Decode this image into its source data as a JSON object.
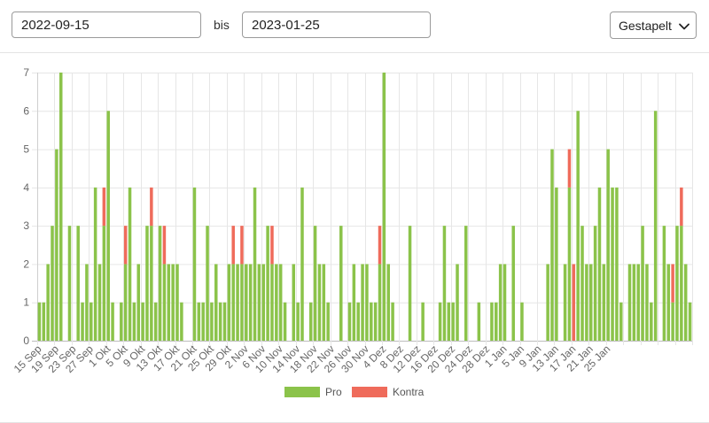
{
  "filter": {
    "from_value": "2022-09-15",
    "separator": "bis",
    "to_value": "2023-01-25",
    "mode_label": "Gestapelt"
  },
  "colors": {
    "pro": "#8bc34a",
    "kontra": "#ef6b5b"
  },
  "chart_data": {
    "type": "bar",
    "stacked": true,
    "title": "",
    "xlabel": "",
    "ylabel": "",
    "ylim": [
      0,
      7
    ],
    "yticks": [
      0,
      1,
      2,
      3,
      4,
      5,
      6,
      7
    ],
    "grid": true,
    "legend_position": "bottom",
    "x_start": "2022-09-15",
    "x_tick_labels": [
      "15 Sep",
      "19 Sep",
      "23 Sep",
      "27 Sep",
      "1 Okt",
      "5 Okt",
      "9 Okt",
      "13 Okt",
      "17 Okt",
      "21 Okt",
      "25 Okt",
      "29 Okt",
      "2 Nov",
      "6 Nov",
      "10 Nov",
      "14 Nov",
      "18 Nov",
      "22 Nov",
      "26 Nov",
      "30 Nov",
      "4 Dez",
      "8 Dez",
      "12 Dez",
      "16 Dez",
      "20 Dez",
      "24 Dez",
      "28 Dez",
      "1 Jan",
      "5 Jan",
      "9 Jan",
      "13 Jan",
      "17 Jan",
      "21 Jan",
      "25 Jan"
    ],
    "series": [
      {
        "name": "Pro",
        "values": [
          1,
          1,
          2,
          3,
          5,
          7,
          0,
          3,
          0,
          3,
          1,
          2,
          1,
          4,
          2,
          3,
          6,
          1,
          0,
          1,
          2,
          4,
          1,
          2,
          1,
          3,
          3,
          1,
          3,
          2,
          2,
          2,
          2,
          1,
          0,
          0,
          4,
          1,
          1,
          3,
          1,
          2,
          1,
          1,
          2,
          2,
          2,
          2,
          2,
          2,
          4,
          2,
          2,
          3,
          2,
          2,
          2,
          1,
          0,
          2,
          1,
          4,
          0,
          1,
          3,
          2,
          2,
          1,
          0,
          0,
          3,
          0,
          1,
          2,
          1,
          2,
          2,
          1,
          1,
          2,
          7,
          2,
          1,
          0,
          0,
          0,
          3,
          0,
          0,
          1,
          0,
          0,
          0,
          1,
          3,
          1,
          1,
          2,
          0,
          3,
          0,
          0,
          1,
          0,
          0,
          1,
          1,
          2,
          2,
          0,
          3,
          0,
          1,
          0,
          0,
          0,
          0,
          0,
          2,
          5,
          4,
          0,
          2,
          4,
          0,
          6,
          3,
          2,
          2,
          3,
          4,
          2,
          5,
          4,
          4,
          1,
          0,
          2,
          2,
          2,
          3,
          2,
          1,
          6,
          0,
          3,
          2,
          1,
          3,
          3,
          2,
          1
        ],
        "source": "read from chart"
      },
      {
        "name": "Kontra",
        "values": [
          0,
          0,
          0,
          0,
          0,
          0,
          0,
          0,
          0,
          0,
          0,
          0,
          0,
          0,
          0,
          1,
          0,
          0,
          0,
          0,
          1,
          0,
          0,
          0,
          0,
          0,
          1,
          0,
          0,
          1,
          0,
          0,
          0,
          0,
          0,
          0,
          0,
          0,
          0,
          0,
          0,
          0,
          0,
          0,
          0,
          1,
          0,
          1,
          0,
          0,
          0,
          0,
          0,
          0,
          1,
          0,
          0,
          0,
          0,
          0,
          0,
          0,
          0,
          0,
          0,
          0,
          0,
          0,
          0,
          0,
          0,
          0,
          0,
          0,
          0,
          0,
          0,
          0,
          0,
          1,
          0,
          0,
          0,
          0,
          0,
          0,
          0,
          0,
          0,
          0,
          0,
          0,
          0,
          0,
          0,
          0,
          0,
          0,
          0,
          0,
          0,
          0,
          0,
          0,
          0,
          0,
          0,
          0,
          0,
          0,
          0,
          0,
          0,
          0,
          0,
          0,
          0,
          0,
          0,
          0,
          0,
          0,
          0,
          1,
          2,
          0,
          0,
          0,
          0,
          0,
          0,
          0,
          0,
          0,
          0,
          0,
          0,
          0,
          0,
          0,
          0,
          0,
          0,
          0,
          0,
          0,
          0,
          1,
          0,
          1,
          0,
          0
        ]
      }
    ]
  }
}
